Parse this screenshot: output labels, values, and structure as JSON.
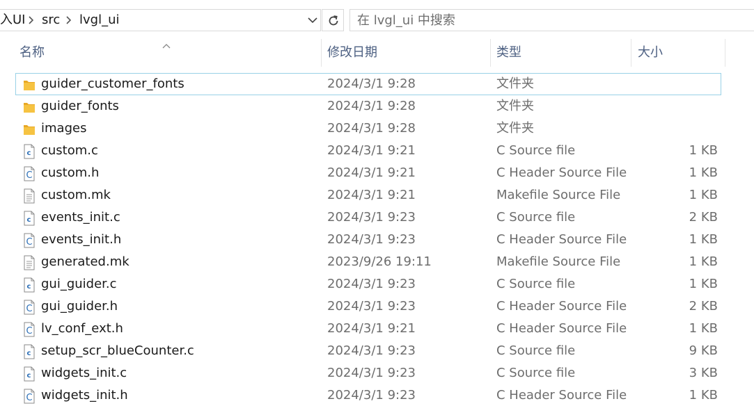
{
  "address_bar": {
    "crumbs": [
      {
        "label": "入UI"
      },
      {
        "label": "src"
      },
      {
        "label": "lvgl_ui"
      }
    ]
  },
  "search": {
    "placeholder": "在 lvgl_ui 中搜索",
    "value": ""
  },
  "columns": {
    "name": "名称",
    "date": "修改日期",
    "type": "类型",
    "size": "大小",
    "sort_column": "name",
    "sort_direction": "ascending"
  },
  "files": [
    {
      "name": "guider_customer_fonts",
      "date": "2024/3/1 9:28",
      "type": "文件夹",
      "size": "",
      "icon": "folder-icon"
    },
    {
      "name": "guider_fonts",
      "date": "2024/3/1 9:28",
      "type": "文件夹",
      "size": "",
      "icon": "folder-icon"
    },
    {
      "name": "images",
      "date": "2024/3/1 9:28",
      "type": "文件夹",
      "size": "",
      "icon": "folder-icon"
    },
    {
      "name": "custom.c",
      "date": "2024/3/1 9:21",
      "type": "C Source file",
      "size": "1 KB",
      "icon": "c-source-file-icon"
    },
    {
      "name": "custom.h",
      "date": "2024/3/1 9:21",
      "type": "C Header Source File",
      "size": "1 KB",
      "icon": "c-header-file-icon"
    },
    {
      "name": "custom.mk",
      "date": "2024/3/1 9:21",
      "type": "Makefile Source File",
      "size": "1 KB",
      "icon": "makefile-icon"
    },
    {
      "name": "events_init.c",
      "date": "2024/3/1 9:23",
      "type": "C Source file",
      "size": "2 KB",
      "icon": "c-source-file-icon"
    },
    {
      "name": "events_init.h",
      "date": "2024/3/1 9:23",
      "type": "C Header Source File",
      "size": "1 KB",
      "icon": "c-header-file-icon"
    },
    {
      "name": "generated.mk",
      "date": "2023/9/26 19:11",
      "type": "Makefile Source File",
      "size": "1 KB",
      "icon": "makefile-icon"
    },
    {
      "name": "gui_guider.c",
      "date": "2024/3/1 9:23",
      "type": "C Source file",
      "size": "1 KB",
      "icon": "c-source-file-icon"
    },
    {
      "name": "gui_guider.h",
      "date": "2024/3/1 9:23",
      "type": "C Header Source File",
      "size": "2 KB",
      "icon": "c-header-file-icon"
    },
    {
      "name": "lv_conf_ext.h",
      "date": "2024/3/1 9:21",
      "type": "C Header Source File",
      "size": "1 KB",
      "icon": "c-header-file-icon"
    },
    {
      "name": "setup_scr_blueCounter.c",
      "date": "2024/3/1 9:23",
      "type": "C Source file",
      "size": "9 KB",
      "icon": "c-source-file-icon"
    },
    {
      "name": "widgets_init.c",
      "date": "2024/3/1 9:23",
      "type": "C Source file",
      "size": "3 KB",
      "icon": "c-source-file-icon"
    },
    {
      "name": "widgets_init.h",
      "date": "2024/3/1 9:23",
      "type": "C Header Source File",
      "size": "1 KB",
      "icon": "c-header-file-icon"
    }
  ],
  "focused_index": 0,
  "colors": {
    "header_text": "#4d6082",
    "detail_text": "#6d6d6d",
    "focus_border": "#99d1e6",
    "folder": "#f6c342",
    "c_badge": "#2c6fb7"
  }
}
